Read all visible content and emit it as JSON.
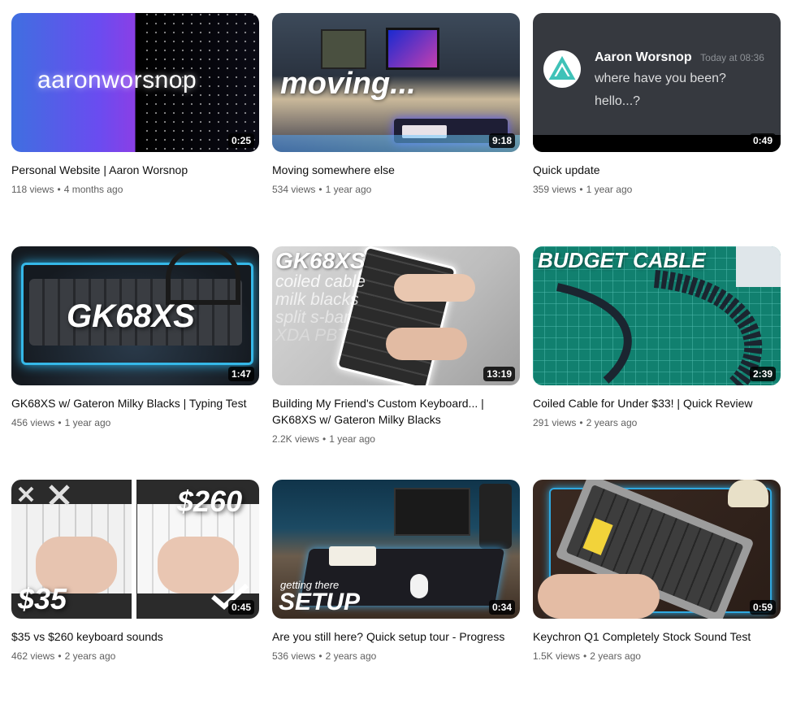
{
  "videos": [
    {
      "title": "Personal Website | Aaron Worsnop",
      "views": "118 views",
      "age": "4 months ago",
      "duration": "0:25",
      "thumb": {
        "overlay": "aaronworsnop"
      }
    },
    {
      "title": "Moving somewhere else",
      "views": "534 views",
      "age": "1 year ago",
      "duration": "9:18",
      "thumb": {
        "overlay": "moving..."
      }
    },
    {
      "title": "Quick update",
      "views": "359 views",
      "age": "1 year ago",
      "duration": "0:49",
      "thumb": {
        "name": "Aaron Worsnop",
        "time": "Today at 08:36",
        "line1": "where have you been?",
        "line2": "hello...?"
      }
    },
    {
      "title": "GK68XS w/ Gateron Milky Blacks | Typing Test",
      "views": "456 views",
      "age": "1 year ago",
      "duration": "1:47",
      "thumb": {
        "overlay": "GK68XS"
      }
    },
    {
      "title": "Building My Friend's Custom Keyboard... | GK68XS w/ Gateron Milky Blacks",
      "views": "2.2K views",
      "age": "1 year ago",
      "duration": "13:19",
      "thumb": {
        "overlay": "GK68XS",
        "lines": [
          "coiled cable",
          "milk blacks",
          "split s-bar",
          "XDA PBT"
        ]
      }
    },
    {
      "title": "Coiled Cable for Under $33! | Quick Review",
      "views": "291 views",
      "age": "2 years ago",
      "duration": "2:39",
      "thumb": {
        "overlay": "BUDGET CABLE"
      }
    },
    {
      "title": "$35 vs $260 keyboard sounds",
      "views": "462 views",
      "age": "2 years ago",
      "duration": "0:45",
      "thumb": {
        "left": "$35",
        "right": "$260"
      }
    },
    {
      "title": "Are you still here? Quick setup tour - Progress",
      "views": "536 views",
      "age": "2 years ago",
      "duration": "0:34",
      "thumb": {
        "small": "getting there",
        "overlay": "SETUP"
      }
    },
    {
      "title": "Keychron Q1 Completely Stock Sound Test",
      "views": "1.5K views",
      "age": "2 years ago",
      "duration": "0:59",
      "thumb": {}
    }
  ]
}
